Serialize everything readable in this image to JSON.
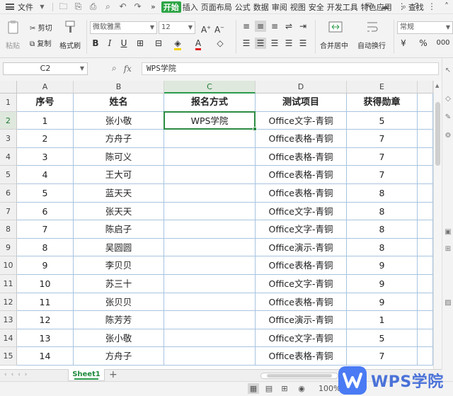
{
  "menubar": {
    "file_label": "文件",
    "tabs": [
      "开始",
      "插入",
      "页面布局",
      "公式",
      "数据",
      "审阅",
      "视图",
      "安全",
      "开发工具",
      "特色应用"
    ],
    "active_tab": "开始",
    "search_label": "查找",
    "more": "»"
  },
  "ribbon": {
    "paste": "粘贴",
    "cut": "剪切",
    "copy": "复制",
    "format_painter": "格式刷",
    "font_name": "微软雅黑",
    "font_size": "12",
    "merge_center": "合并居中",
    "wrap_text": "自动换行",
    "number_format": "常规",
    "currency_symbol": "¥",
    "percent_symbol": "%",
    "thousands_symbol": "000"
  },
  "formula_bar": {
    "name_box": "C2",
    "fx_label": "fx",
    "formula_value": "WPS学院"
  },
  "sheet": {
    "columns": [
      "A",
      "B",
      "C",
      "D",
      "E"
    ],
    "row_numbers": [
      "1",
      "2",
      "3",
      "4",
      "5",
      "6",
      "7",
      "8",
      "9",
      "10",
      "11",
      "12",
      "13",
      "14",
      "15"
    ],
    "header": [
      "序号",
      "姓名",
      "报名方式",
      "测试项目",
      "获得勋章"
    ],
    "rows": [
      [
        "1",
        "张小敬",
        "WPS学院",
        "Office文字-青铜",
        "5"
      ],
      [
        "2",
        "方舟子",
        "",
        "Office表格-青铜",
        "7"
      ],
      [
        "3",
        "陈可义",
        "",
        "Office表格-青铜",
        "7"
      ],
      [
        "4",
        "王大可",
        "",
        "Office表格-青铜",
        "7"
      ],
      [
        "5",
        "蓝天天",
        "",
        "Office表格-青铜",
        "8"
      ],
      [
        "6",
        "张天天",
        "",
        "Office文字-青铜",
        "8"
      ],
      [
        "7",
        "陈启子",
        "",
        "Office文字-青铜",
        "8"
      ],
      [
        "8",
        "吴圆圆",
        "",
        "Office演示-青铜",
        "8"
      ],
      [
        "9",
        "李贝贝",
        "",
        "Office表格-青铜",
        "9"
      ],
      [
        "10",
        "苏三十",
        "",
        "Office文字-青铜",
        "9"
      ],
      [
        "11",
        "张贝贝",
        "",
        "Office表格-青铜",
        "9"
      ],
      [
        "12",
        "陈芳芳",
        "",
        "Office演示-青铜",
        "1"
      ],
      [
        "13",
        "张小敬",
        "",
        "Office文字-青铜",
        "5"
      ],
      [
        "14",
        "方舟子",
        "",
        "Office表格-青铜",
        "7"
      ]
    ],
    "active_cell": "C2",
    "tab_name": "Sheet1",
    "add_tab": "+"
  },
  "statusbar": {
    "zoom": "100%",
    "zoom_minus": "−"
  },
  "watermark": {
    "text": "WPS学院"
  },
  "colors": {
    "accent": "#2c9a4b",
    "grid_line": "#a8c4e0",
    "brand_blue": "#4a7bf4"
  }
}
